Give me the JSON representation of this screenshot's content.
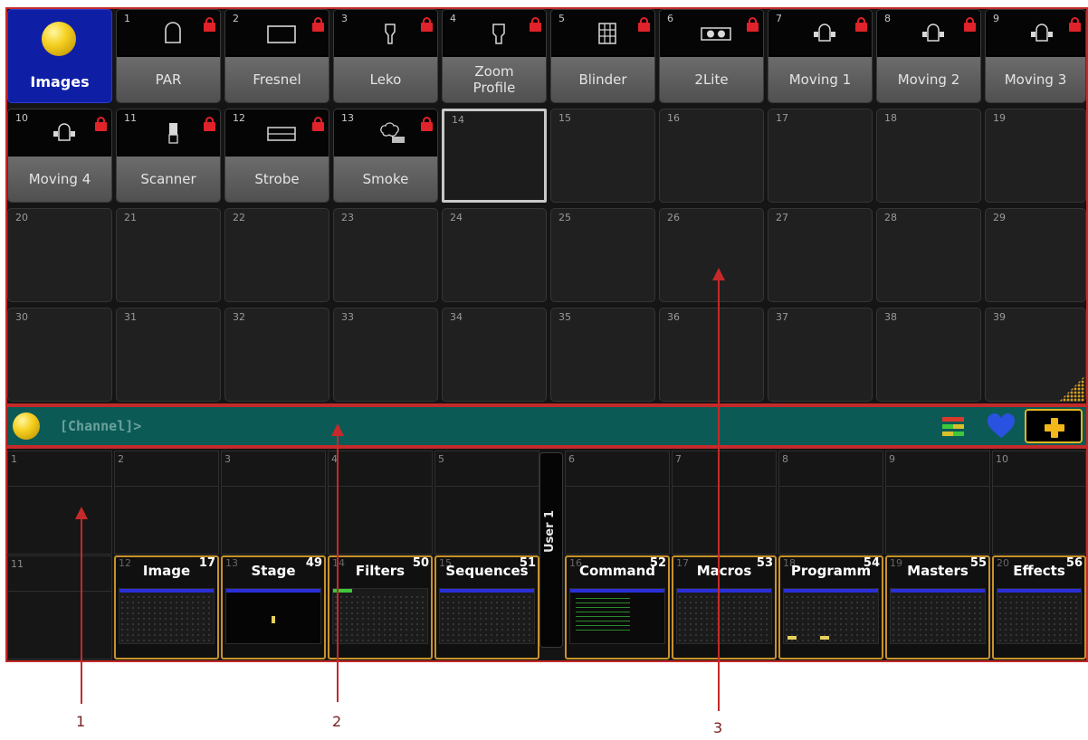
{
  "top_pool": {
    "images_label": "Images",
    "fixture_types": [
      {
        "num": "1",
        "label": "PAR",
        "icon": "par-icon"
      },
      {
        "num": "2",
        "label": "Fresnel",
        "icon": "fresnel-icon"
      },
      {
        "num": "3",
        "label": "Leko",
        "icon": "leko-icon"
      },
      {
        "num": "4",
        "label": "Zoom\nProfile",
        "icon": "zoom-profile-icon"
      },
      {
        "num": "5",
        "label": "Blinder",
        "icon": "blinder-icon"
      },
      {
        "num": "6",
        "label": "2Lite",
        "icon": "two-lite-icon"
      },
      {
        "num": "7",
        "label": "Moving 1",
        "icon": "moving-head-icon"
      },
      {
        "num": "8",
        "label": "Moving 2",
        "icon": "moving-head-icon"
      },
      {
        "num": "9",
        "label": "Moving 3",
        "icon": "moving-head-icon"
      },
      {
        "num": "10",
        "label": "Moving 4",
        "icon": "moving-head-icon"
      },
      {
        "num": "11",
        "label": "Scanner",
        "icon": "scanner-icon"
      },
      {
        "num": "12",
        "label": "Strobe",
        "icon": "strobe-icon"
      },
      {
        "num": "13",
        "label": "Smoke",
        "icon": "smoke-icon"
      }
    ],
    "selected_cell": "14",
    "empty_cells": [
      "15",
      "16",
      "17",
      "18",
      "19",
      "20",
      "21",
      "22",
      "23",
      "24",
      "25",
      "26",
      "27",
      "28",
      "29",
      "30",
      "31",
      "32",
      "33",
      "34",
      "35",
      "36",
      "37",
      "38",
      "39"
    ]
  },
  "command_line": {
    "prompt": "[Channel]>"
  },
  "view_bar": {
    "empty_row1": [
      "1",
      "2",
      "3",
      "4",
      "5",
      "6",
      "7",
      "8",
      "9",
      "10"
    ],
    "empty_11": "11",
    "user_tab": "User 1",
    "views": [
      {
        "num": "12",
        "name": "Image",
        "count": "17"
      },
      {
        "num": "13",
        "name": "Stage",
        "count": "49"
      },
      {
        "num": "14",
        "name": "Filters",
        "count": "50"
      },
      {
        "num": "15",
        "name": "Sequences",
        "count": "51"
      },
      {
        "num": "16",
        "name": "Command",
        "count": "52"
      },
      {
        "num": "17",
        "name": "Macros",
        "count": "53"
      },
      {
        "num": "18",
        "name": "Programm",
        "count": "54"
      },
      {
        "num": "19",
        "name": "Masters",
        "count": "55"
      },
      {
        "num": "20",
        "name": "Effects",
        "count": "56"
      }
    ]
  },
  "callouts": [
    "1",
    "2",
    "3"
  ],
  "colors": {
    "highlight_border": "#c42a2a",
    "images_blue": "#0e1fa6",
    "command_line_teal": "#0c5a56",
    "view_border_gold": "#c8922a",
    "lock_red": "#e0222a"
  }
}
